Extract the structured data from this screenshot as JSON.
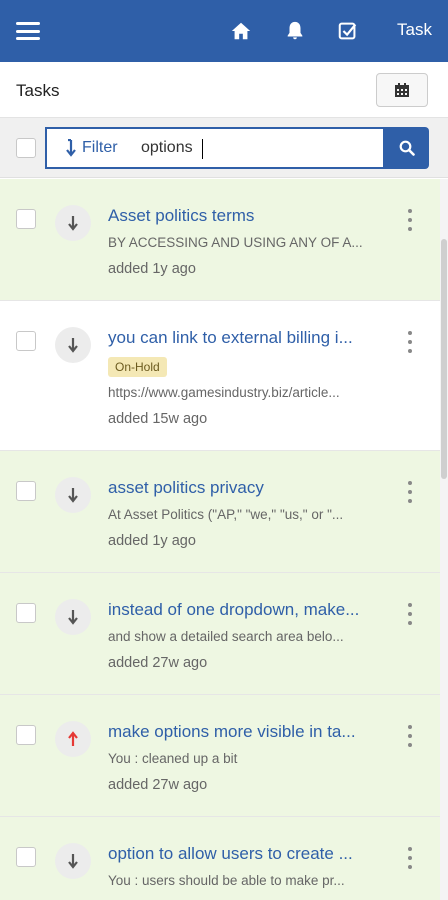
{
  "topbar": {
    "task_label": "Task",
    "icons": [
      "menu-icon",
      "home-icon",
      "bell-icon",
      "check-square-icon"
    ],
    "bg_color": "#2f5fa8"
  },
  "header": {
    "title": "Tasks",
    "calendar_icon": "calendar-icon"
  },
  "filter": {
    "filter_label": "Filter",
    "search_value": "options",
    "search_icon": "search-icon"
  },
  "tasks": [
    {
      "title": "Asset politics terms",
      "desc": "BY ACCESSING AND USING ANY OF A...",
      "added": "added 1y ago",
      "priority": "down",
      "bg": "green"
    },
    {
      "title": "you can link to external billing i...",
      "badge": "On-Hold",
      "desc": "https://www.gamesindustry.biz/article...",
      "added": "added 15w ago",
      "priority": "down",
      "bg": "white"
    },
    {
      "title": "asset politics privacy",
      "desc": "At Asset Politics (\"AP,\" \"we,\" \"us,\" or \"...",
      "added": "added 1y ago",
      "priority": "down",
      "bg": "green"
    },
    {
      "title": "instead of one dropdown, make...",
      "desc": "and show a detailed search area belo...",
      "added": "added 27w ago",
      "priority": "down",
      "bg": "green"
    },
    {
      "title": "make options more visible in ta...",
      "desc": "You : cleaned up a bit",
      "added": "added 27w ago",
      "priority": "up",
      "bg": "green"
    },
    {
      "title": "option to allow users to create ...",
      "desc": "You : users should be able to make pr...",
      "added": "",
      "priority": "down",
      "bg": "green"
    }
  ],
  "colors": {
    "accent": "#2f5fa8",
    "row_green": "#eef7e2",
    "priority_up": "#e53935",
    "badge": "#f4e8b5"
  }
}
